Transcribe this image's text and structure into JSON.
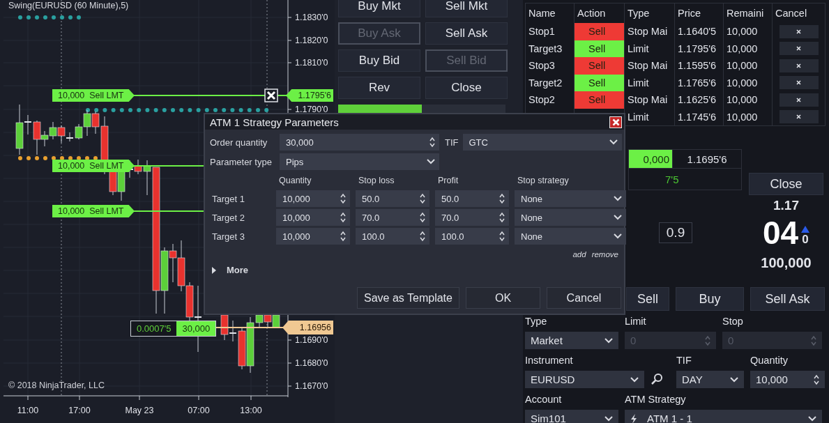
{
  "chart": {
    "title": "Swing(EURUSD (60 Minute),5)",
    "price_axis": [
      "1.1830'0",
      "1.1820'0",
      "1.1810'0",
      "1.1790'0",
      "1.1690'0",
      "1.1680'0",
      "1.1670'0"
    ],
    "time_axis": [
      "11:00",
      "17:00",
      "May 23",
      "07:00",
      "13:00"
    ],
    "orders": [
      {
        "quantity": "10,000",
        "label": "Sell LMT"
      },
      {
        "quantity": "10,000",
        "label": "Sell LMT"
      },
      {
        "quantity": "10,000",
        "label": "Sell LMT"
      }
    ],
    "order_price": "1.1795'6",
    "position": {
      "pnl": "0.0007'5",
      "quantity": "30,000",
      "price": "1.16956"
    },
    "copyright": "© 2018 NinjaTrader, LLC"
  },
  "trade_buttons": [
    {
      "label": "Buy Mkt",
      "disabled": false
    },
    {
      "label": "Sell Mkt",
      "disabled": false
    },
    {
      "label": "Buy Ask",
      "disabled": true
    },
    {
      "label": "Sell Ask",
      "disabled": false
    },
    {
      "label": "Buy Bid",
      "disabled": false
    },
    {
      "label": "Sell Bid",
      "disabled": true
    },
    {
      "label": "Rev",
      "disabled": false
    },
    {
      "label": "Close",
      "disabled": false
    }
  ],
  "orders_table": {
    "columns": [
      "Name",
      "Action",
      "Type",
      "Price",
      "Remaini",
      "Cancel"
    ],
    "rows": [
      {
        "name": "Stop1",
        "action": "Sell",
        "color": "#ee3a35",
        "type": "Stop Mai",
        "price": "1.1640'5",
        "remaining": "10,000"
      },
      {
        "name": "Target3",
        "action": "Sell",
        "color": "#6cf046",
        "type": "Limit",
        "price": "1.1795'6",
        "remaining": "10,000"
      },
      {
        "name": "Stop3",
        "action": "Sell",
        "color": "#ee3a35",
        "type": "Stop Mai",
        "price": "1.1595'6",
        "remaining": "10,000"
      },
      {
        "name": "Target2",
        "action": "Sell",
        "color": "#6cf046",
        "type": "Limit",
        "price": "1.1765'6",
        "remaining": "10,000"
      },
      {
        "name": "Stop2",
        "action": "Sell",
        "color": "#ee3a35",
        "type": "Stop Mai",
        "price": "1.1625'6",
        "remaining": "10,000"
      },
      {
        "type": "Limit",
        "price": "1.1745'6",
        "remaining": "10,000"
      }
    ]
  },
  "position": {
    "quantity": "0,000",
    "price": "1.1695'6",
    "pnl": "7'5"
  },
  "close_button": "Close",
  "quote": {
    "big_figure": "1.17",
    "pips": "04",
    "fraction": "0",
    "size": "100,000",
    "spread": "0.9"
  },
  "order_buttons": [
    "Sell",
    "Buy",
    "Sell Ask"
  ],
  "order_form": {
    "type": {
      "label": "Type",
      "value": "Market"
    },
    "limit": {
      "label": "Limit",
      "placeholder": "0",
      "disabled": true
    },
    "stop": {
      "label": "Stop",
      "placeholder": "0",
      "disabled": true
    },
    "instrument": {
      "label": "Instrument",
      "value": "EURUSD"
    },
    "tif": {
      "label": "TIF",
      "value": "DAY"
    },
    "quantity": {
      "label": "Quantity",
      "value": "10,000"
    },
    "account": {
      "label": "Account",
      "value": "Sim101"
    },
    "atm_strategy": {
      "label": "ATM Strategy",
      "value": "ATM 1 - 1"
    }
  },
  "dialog": {
    "title": "ATM 1 Strategy Parameters",
    "order_quantity": {
      "label": "Order quantity",
      "value": "30,000"
    },
    "tif": {
      "label": "TIF",
      "value": "GTC"
    },
    "parameter_type": {
      "label": "Parameter type",
      "value": "Pips"
    },
    "columns": [
      "Quantity",
      "Stop loss",
      "Profit",
      "Stop strategy"
    ],
    "targets": [
      {
        "name": "Target 1",
        "quantity": "10,000",
        "stop_loss": "50.0",
        "profit": "50.0",
        "stop_strategy": "None"
      },
      {
        "name": "Target 2",
        "quantity": "10,000",
        "stop_loss": "70.0",
        "profit": "70.0",
        "stop_strategy": "None"
      },
      {
        "name": "Target 3",
        "quantity": "10,000",
        "stop_loss": "100.0",
        "profit": "100.0",
        "stop_strategy": "None"
      }
    ],
    "links": [
      "add",
      "remove"
    ],
    "more": {
      "label": "More",
      "expanded": false
    },
    "buttons": [
      "Save as Template",
      "OK",
      "Cancel"
    ]
  }
}
